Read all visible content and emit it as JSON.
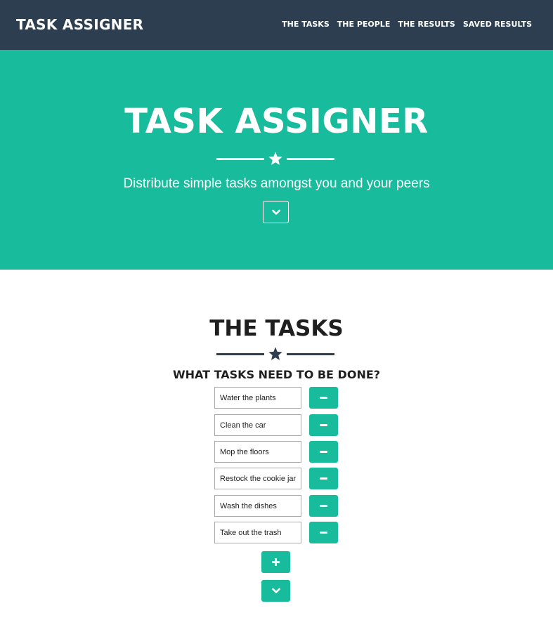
{
  "navbar": {
    "brand": "TASK ASSIGNER",
    "links": [
      {
        "label": "THE TASKS"
      },
      {
        "label": "THE PEOPLE"
      },
      {
        "label": "THE RESULTS"
      },
      {
        "label": "SAVED RESULTS"
      }
    ]
  },
  "hero": {
    "title": "TASK ASSIGNER",
    "subtitle": "Distribute simple tasks amongst you and your peers",
    "divider_icon": "star-icon",
    "scroll_icon": "chevron-down-icon"
  },
  "tasks_section": {
    "title": "THE TASKS",
    "divider_icon": "star-icon",
    "question": "WHAT TASKS NEED TO BE DONE?",
    "items": [
      {
        "value": "Water the plants",
        "remove_icon": "minus-icon"
      },
      {
        "value": "Clean the car",
        "remove_icon": "minus-icon"
      },
      {
        "value": "Mop the floors",
        "remove_icon": "minus-icon"
      },
      {
        "value": "Restock the cookie jar",
        "remove_icon": "minus-icon"
      },
      {
        "value": "Wash the dishes",
        "remove_icon": "minus-icon"
      },
      {
        "value": "Take out the trash",
        "remove_icon": "minus-icon"
      }
    ],
    "add_icon": "plus-icon",
    "next_icon": "chevron-down-icon"
  },
  "colors": {
    "navbar": "#2c3e50",
    "accent": "#18bc9c",
    "text_dark": "#1f1f1f",
    "white": "#ffffff"
  }
}
